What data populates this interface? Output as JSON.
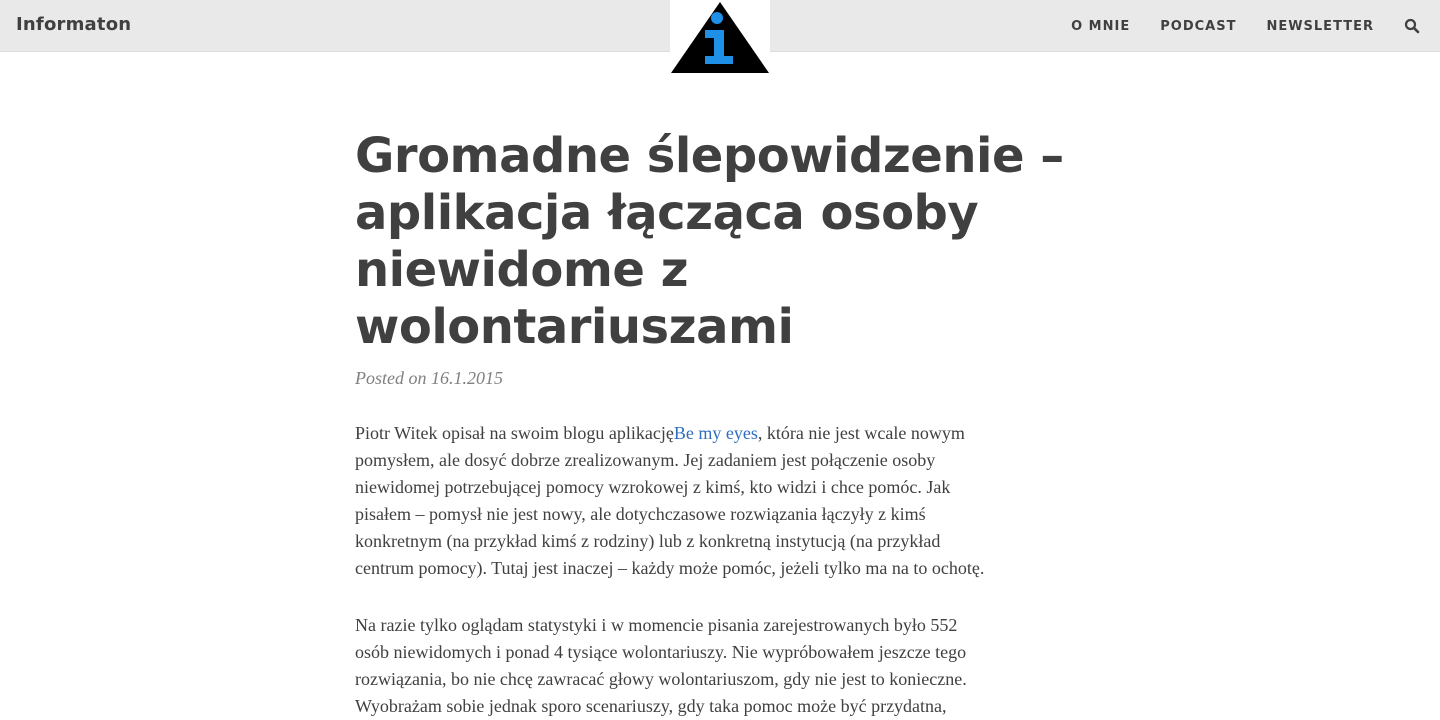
{
  "header": {
    "brand": "Informaton",
    "logo_icon": "info-triangle-icon",
    "nav": [
      "O MNIE",
      "PODCAST",
      "NEWSLETTER"
    ],
    "search_icon": "search-icon"
  },
  "article": {
    "title_lines": [
      "Gromadne ślepowidzenie –",
      "aplikacja łącząca osoby",
      "niewidome z",
      "wolontariuszami"
    ],
    "posted_prefix": "Posted on",
    "date": "16.1.2015",
    "p1_before": "Piotr Witek opisał na swoim blogu aplikację",
    "p1_link": "Be my eyes",
    "p1_lines": [
      ", która nie jest wcale nowym",
      "pomysłem, ale dosyć dobrze zrealizowanym. Jej zadaniem jest połączenie osoby",
      "niewidomej potrzebującej pomocy wzrokowej z kimś, kto widzi i chce pomóc. Jak",
      "pisałem – pomysł nie jest nowy, ale dotychczasowe rozwiązania łączyły z kimś",
      "konkretnym (na przykład kimś z rodziny) lub z konkretną instytucją (na przykład",
      "centrum pomocy). Tutaj jest inaczej – każdy może pomóc, jeżeli tylko ma na to ochotę."
    ],
    "p2_lines": [
      "Na razie tylko oglądam statystyki i w momencie pisania zarejestrowanych było 552",
      "osób niewidomych i ponad 4 tysiące wolontariuszy. Nie wypróbowałem jeszcze tego",
      "rozwiązania, bo nie chcę zawracać głowy wolontariuszom, gdy nie jest to konieczne.",
      "Wyobrażam sobie jednak sporo scenariuszy, gdy taka pomoc może być przydatna,"
    ]
  },
  "colors": {
    "header_bg": "#e9e9e9",
    "text": "#404040",
    "meta": "#808080",
    "link": "#2e6dbf",
    "logo_triangle": "#000000",
    "logo_i": "#1e90e8"
  }
}
